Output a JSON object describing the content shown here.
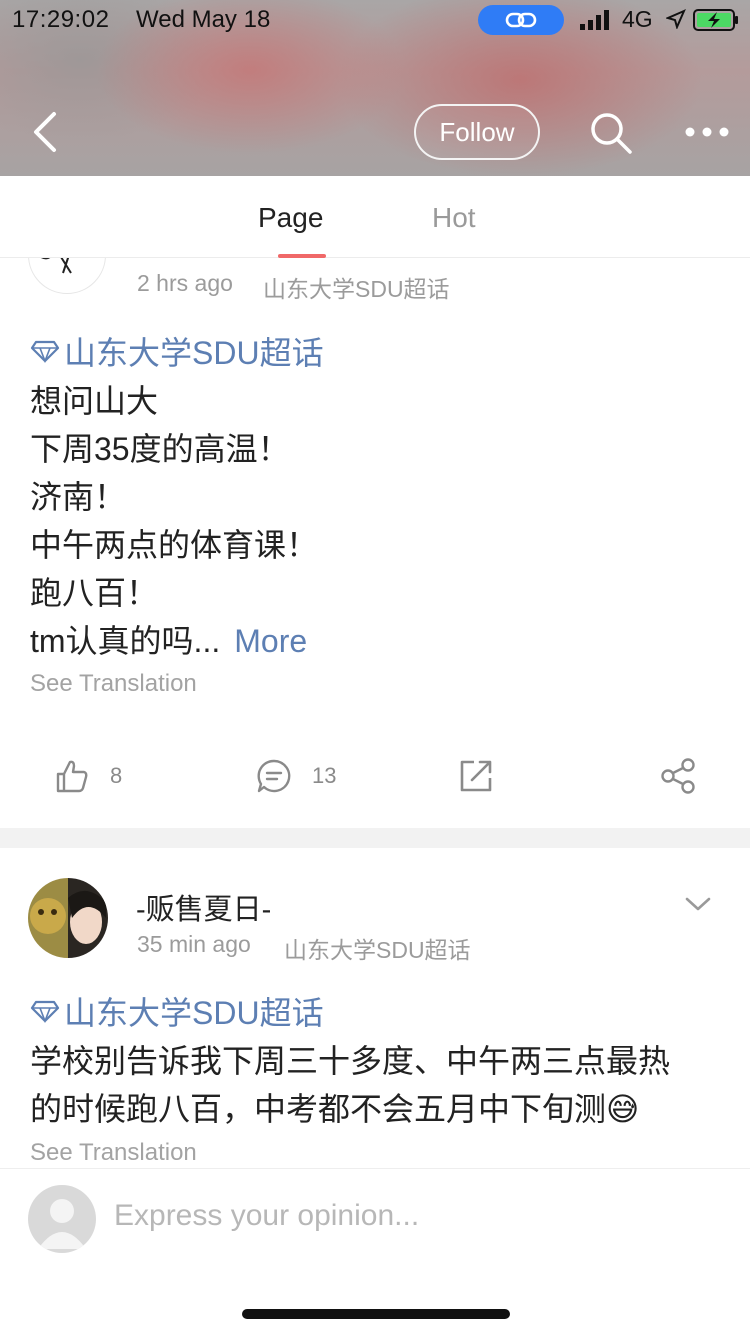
{
  "status_bar": {
    "time": "17:29:02",
    "date": "Wed May 18",
    "network": "4G"
  },
  "header": {
    "follow_label": "Follow"
  },
  "tabs": [
    {
      "label": "Page",
      "active": true
    },
    {
      "label": "Hot",
      "active": false
    }
  ],
  "posts": [
    {
      "time": "2 hrs ago",
      "source": "山东大学SDU超话",
      "topic": "山东大学SDU超话",
      "lines": [
        "想问山大",
        "下周35度的高温！",
        "济南！",
        "中午两点的体育课！",
        "跑八百！",
        "tm认真的吗..."
      ],
      "more_label": "More",
      "translation_label": "See Translation",
      "likes": "8",
      "comments": "13"
    },
    {
      "username": "-贩售夏日-",
      "time": "35 min ago",
      "source": "山东大学SDU超话",
      "topic": "山东大学SDU超话",
      "lines": [
        "学校别告诉我下周三十多度、中午两三点最热",
        "的时候跑八百，中考都不会五月中下旬测😅"
      ],
      "translation_label": "See Translation"
    }
  ],
  "composer": {
    "placeholder": "Express your opinion..."
  },
  "colors": {
    "accent_blue": "#5d7fb3",
    "tab_underline": "#f06868",
    "link_pill": "#2f7cf6",
    "battery_green": "#4cd964"
  }
}
